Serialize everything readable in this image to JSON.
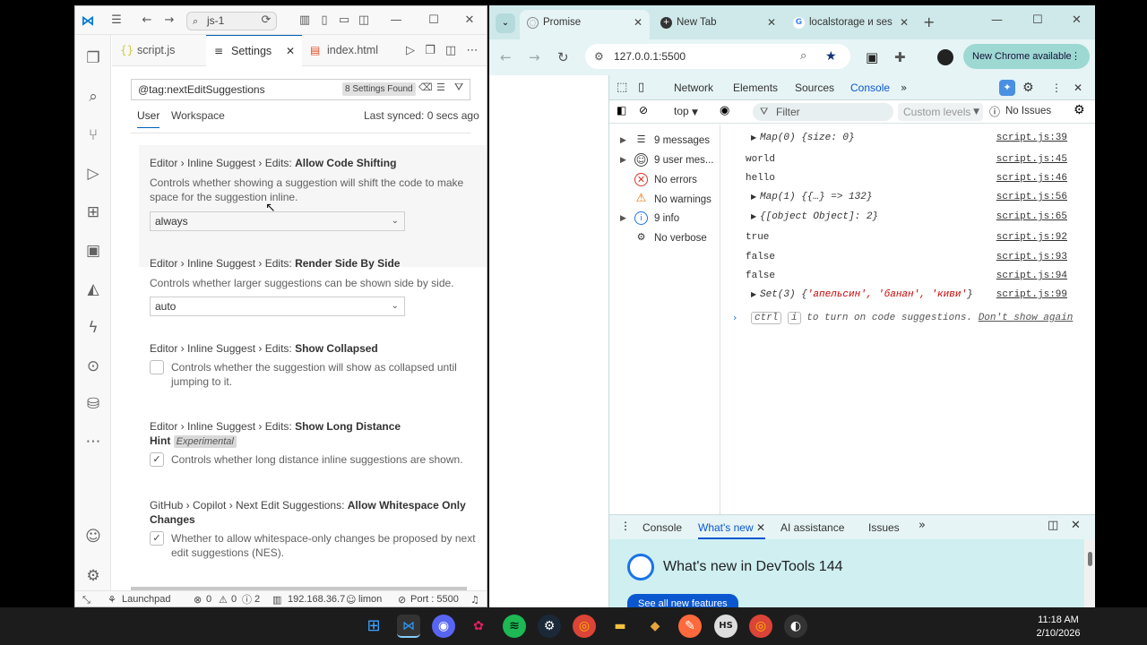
{
  "vscode": {
    "command_center": "js-1",
    "tabs": [
      {
        "label": "script.js"
      },
      {
        "label": "Settings"
      },
      {
        "label": "index.html"
      }
    ],
    "settings": {
      "search_value": "@tag:nextEditSuggestions",
      "found_badge": "8 Settings Found",
      "scope_user": "User",
      "scope_workspace": "Workspace",
      "last_synced": "Last synced: 0 secs ago",
      "items": [
        {
          "prefix": "Editor › Inline Suggest › Edits: ",
          "name": "Allow Code Shifting",
          "desc": "Controls whether showing a suggestion will shift the code to make space for the suggestion inline.",
          "value": "always"
        },
        {
          "prefix": "Editor › Inline Suggest › Edits: ",
          "name": "Render Side By Side",
          "desc": "Controls whether larger suggestions can be shown side by side.",
          "value": "auto"
        },
        {
          "prefix": "Editor › Inline Suggest › Edits: ",
          "name": "Show Collapsed",
          "desc": "Controls whether the suggestion will show as collapsed until jumping to it."
        },
        {
          "prefix": "Editor › Inline Suggest › Edits: ",
          "name": "Show Long Distance",
          "name2": "Hint",
          "badge": "Experimental",
          "desc": "Controls whether long distance inline suggestions are shown."
        },
        {
          "prefix": "GitHub › Copilot › Next Edit Suggestions: ",
          "name": "Allow Whitespace Only",
          "name2": "Changes",
          "desc": "Whether to allow whitespace-only changes be proposed by next edit suggestions (NES)."
        }
      ]
    },
    "status": {
      "launchpad": "Launchpad",
      "problems": "0",
      "warnings": "0",
      "info": "2",
      "ip": "192.168.36.7",
      "user": "limon",
      "port": "Port : 5500"
    }
  },
  "chrome": {
    "tabs": [
      {
        "label": "Promise"
      },
      {
        "label": "New Tab"
      },
      {
        "label": "localstorage и ses"
      }
    ],
    "url": "127.0.0.1:5500",
    "new_chrome": "New Chrome available",
    "devtools": {
      "tabs": [
        "Network",
        "Elements",
        "Sources",
        "Console"
      ],
      "context": "top",
      "filter_placeholder": "Filter",
      "levels": "Custom levels",
      "issues": "No Issues",
      "sidebar": [
        {
          "label": "9 messages"
        },
        {
          "label": "9 user mes..."
        },
        {
          "label": "No errors"
        },
        {
          "label": "No warnings"
        },
        {
          "label": "9 info"
        },
        {
          "label": "No verbose"
        }
      ],
      "logs": [
        {
          "msg": "Map(0) {size: 0}",
          "src": "script.js:39"
        },
        {
          "msg": "world",
          "src": "script.js:45"
        },
        {
          "msg": "hello",
          "src": "script.js:46"
        },
        {
          "msg": "Map(1) {{…} => 132}",
          "src": "script.js:56"
        },
        {
          "msg": "{[object Object]: 2}",
          "src": "script.js:65"
        },
        {
          "msg": "true",
          "src": "script.js:92"
        },
        {
          "msg": "false",
          "src": "script.js:93"
        },
        {
          "msg": "false",
          "src": "script.js:94"
        },
        {
          "msg_prefix": "Set(3) {",
          "set_items": "'апельсин', 'банан', 'киви'",
          "msg_suffix": "}",
          "src": "script.js:99"
        }
      ],
      "hint": {
        "key1": "ctrl",
        "key2": "i",
        "text": "to turn on code suggestions.",
        "link": "Don't show again"
      },
      "drawer_tabs": [
        "Console",
        "What's new",
        "AI assistance",
        "Issues"
      ],
      "whats_new_title": "What's new in DevTools 144",
      "see_all": "See all new features"
    }
  },
  "taskbar": {
    "time": "11:18 AM",
    "date": "2/10/2026"
  },
  "colors": {
    "vscode_accent": "#005fb8",
    "chrome_frame": "#cfe9ea",
    "devtools_active": "#0b57d0",
    "error_red": "#d93025",
    "warning_orange": "#e37400"
  }
}
